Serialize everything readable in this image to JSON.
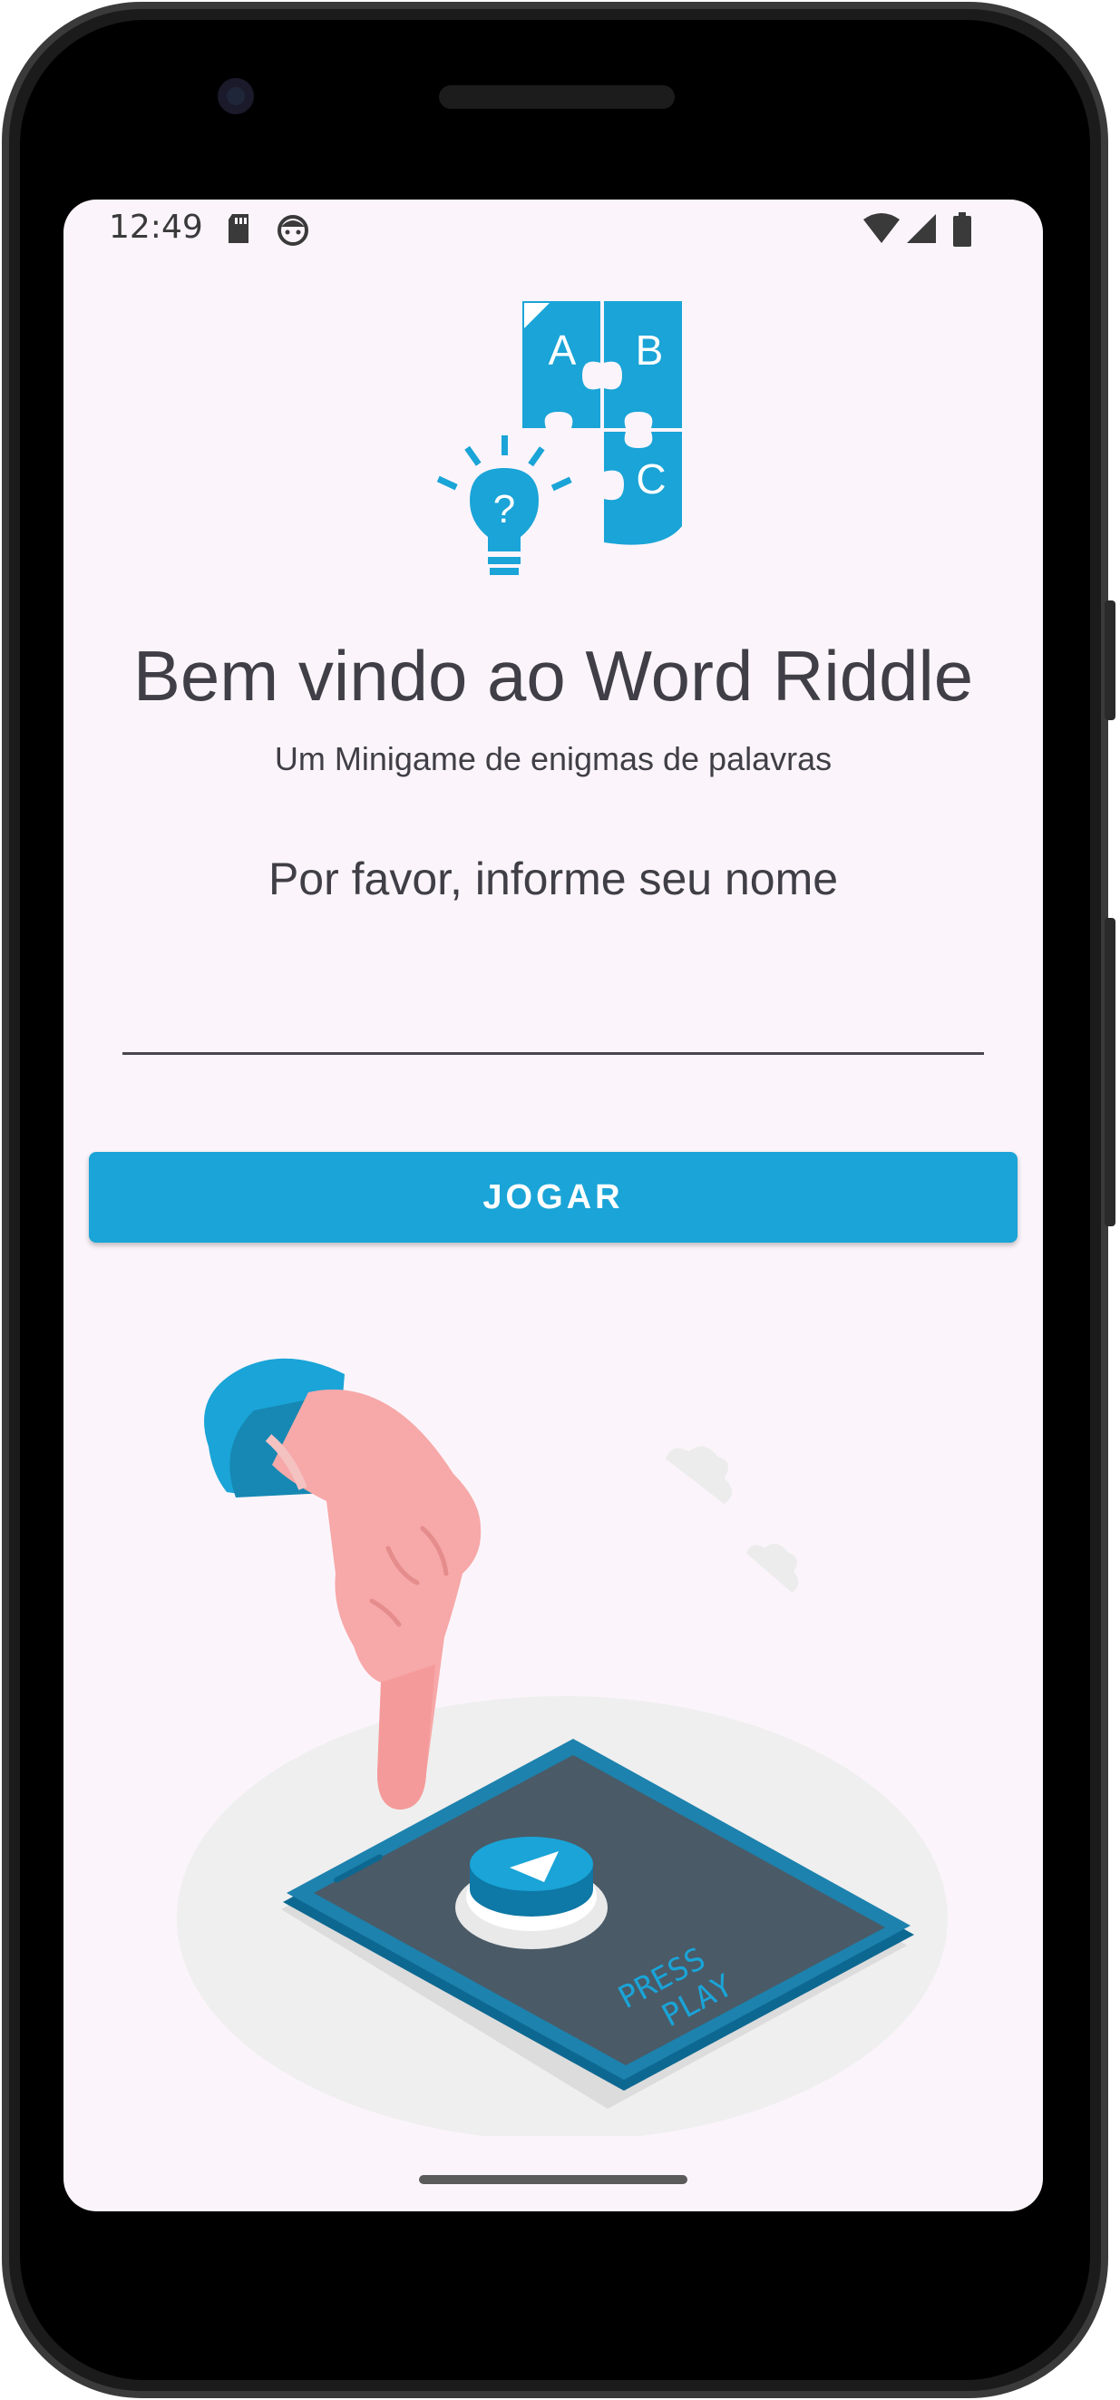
{
  "status_bar": {
    "time": "12:49",
    "left_icons": [
      "sd-card-icon",
      "robot-face-icon"
    ],
    "right_icons": [
      "wifi-icon",
      "cell-signal-icon",
      "battery-icon"
    ]
  },
  "logo": {
    "pieces": [
      "A",
      "B",
      "C"
    ],
    "bulb_mark": "?",
    "icon": "puzzle-lightbulb-logo"
  },
  "welcome": {
    "title": "Bem vindo ao Word Riddle",
    "subtitle": "Um Minigame de enigmas de palavras"
  },
  "form": {
    "prompt": "Por favor, informe seu nome",
    "name_value": "",
    "name_placeholder": ""
  },
  "actions": {
    "play_label": "JOGAR"
  },
  "illustration": {
    "icon": "hand-pressing-play-illustration",
    "screen_text_line1": "PRESS",
    "screen_text_line2": "PLAY"
  },
  "colors": {
    "accent": "#1aa4d7",
    "background": "#fbf5fb",
    "text": "#403e46"
  }
}
